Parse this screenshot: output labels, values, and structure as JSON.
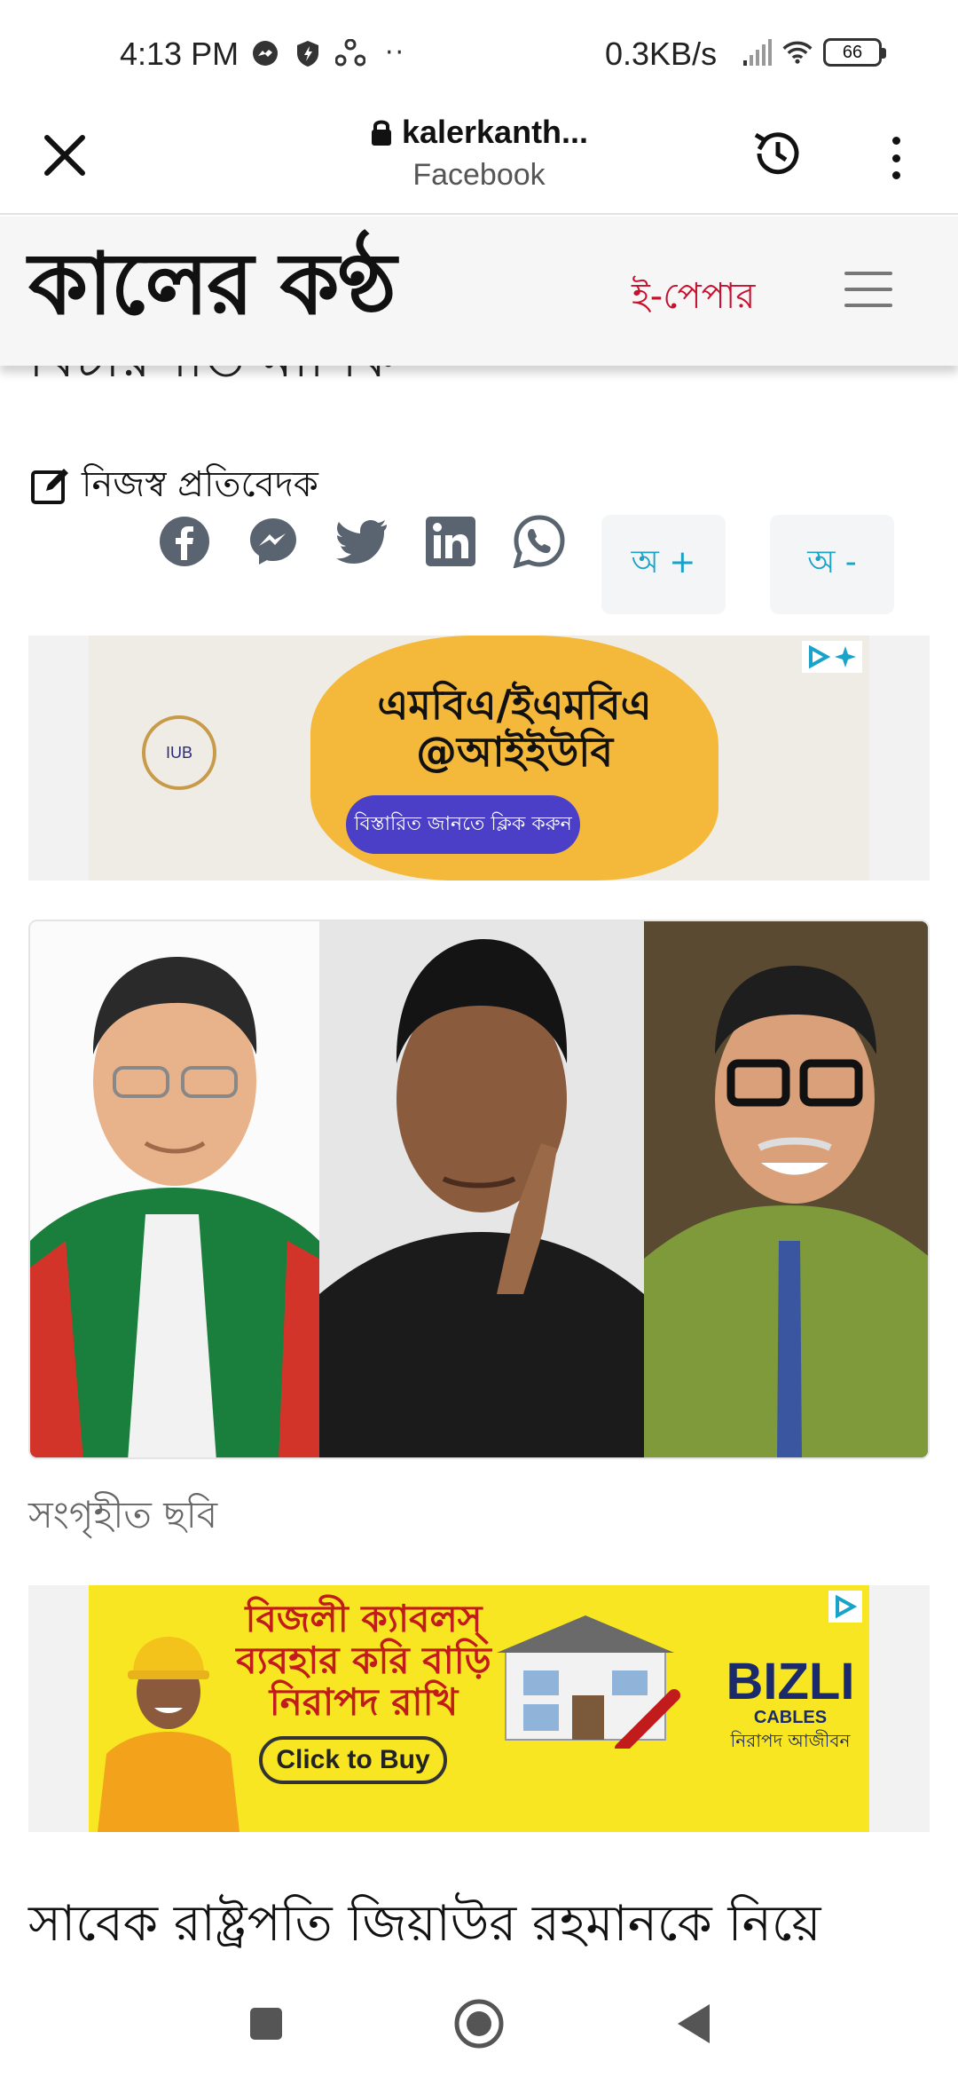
{
  "status_bar": {
    "time": "4:13 PM",
    "dots": "··",
    "speed": "0.3KB/s",
    "battery": "66"
  },
  "browser": {
    "url": "kalerkanth...",
    "source": "Facebook"
  },
  "site": {
    "logo": "কালের কণ্ঠ",
    "epaper": "ই-পেপার"
  },
  "article": {
    "headline_cut": "বিচারপতি মানিক",
    "byline": "নিজস্ব প্রতিবেদক",
    "font_increase": "অ +",
    "font_decrease": "অ -",
    "photo_caption": "সংগৃহীত ছবি",
    "next_paragraph": "সাবেক রাষ্ট্রপতি জিয়াউর রহমানকে নিয়ে"
  },
  "ad1": {
    "headline": "এমবিএ/ইএমবিএ @আইইউবি",
    "cta": "বিস্তারিত জানতে ক্লিক করুন",
    "seal": "IUB"
  },
  "ad2": {
    "headline": "বিজলী ক্যাবলস্ ব্যবহার করি বাড়ি নিরাপদ রাখি",
    "cta": "Click to Buy",
    "brand": "BIZLI",
    "brand_sub": "CABLES",
    "brand_tag": "নিরাপদ আজীবন"
  },
  "colors": {
    "epaper_red": "#c8102e",
    "font_btn_blue": "#1aa3c9",
    "ad2_yellow": "#f8e622",
    "ad1_orange": "#f4b93a",
    "ad1_cta_purple": "#4a3fc6"
  }
}
